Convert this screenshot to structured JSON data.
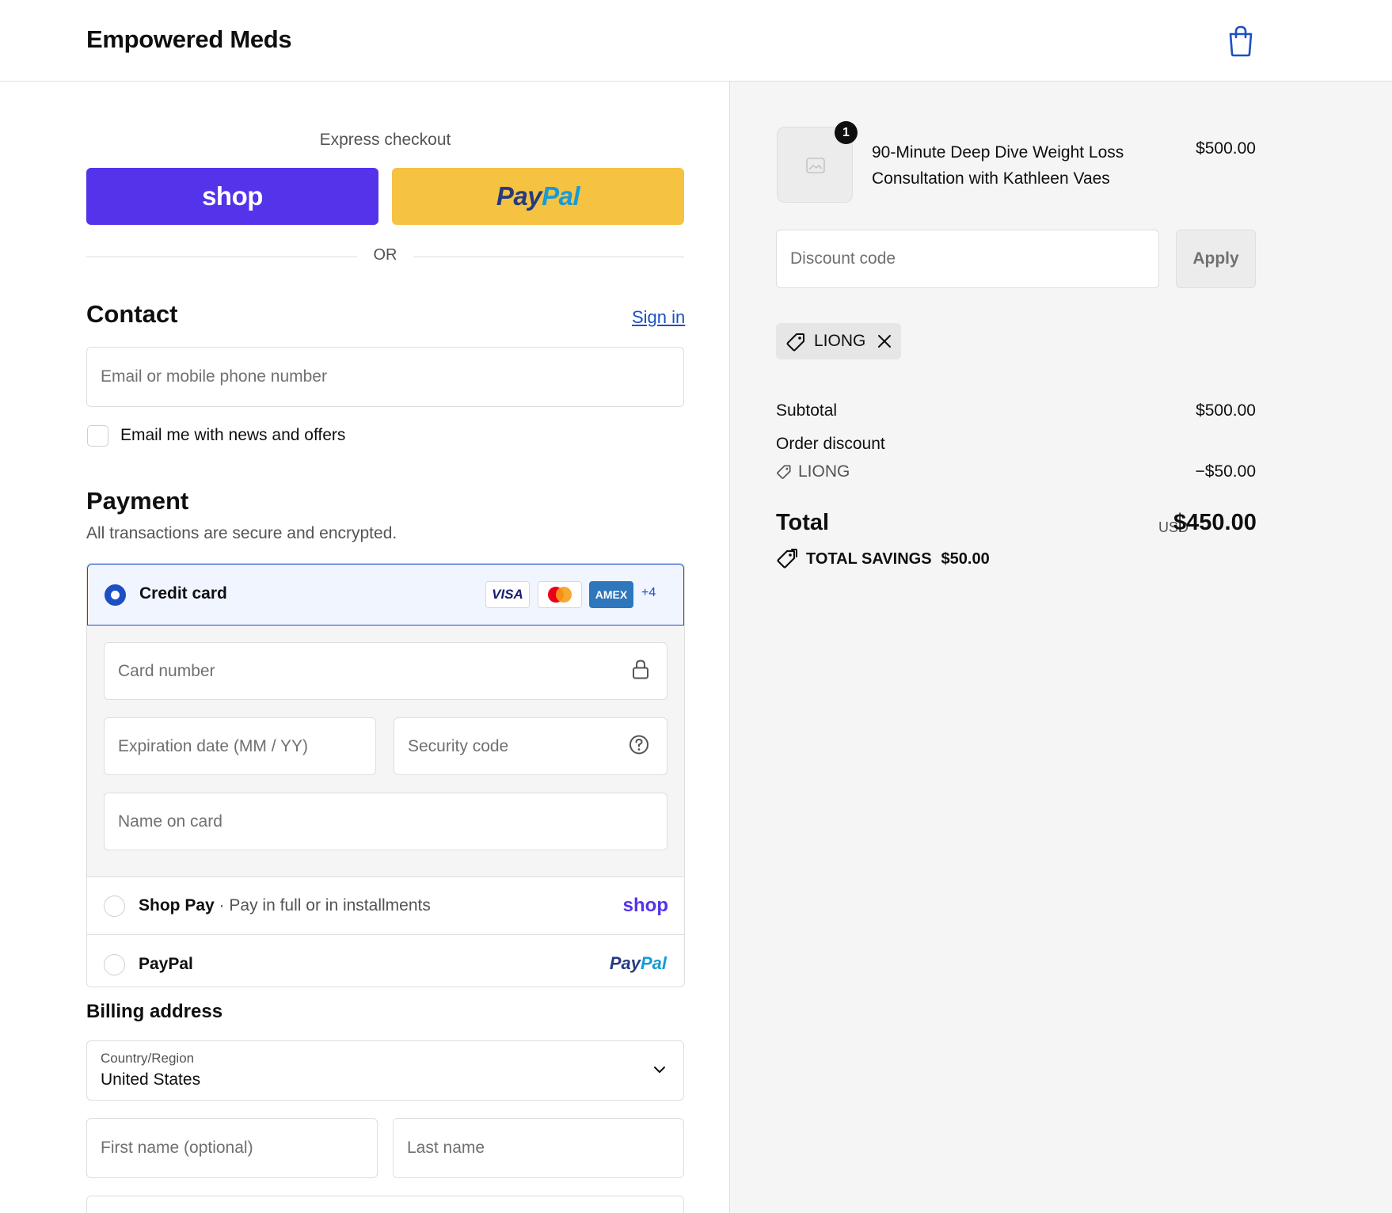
{
  "header": {
    "brand": "Empowered Meds",
    "cart_icon": "shopping-bag-icon"
  },
  "express": {
    "title": "Express checkout",
    "shop_label": "shop",
    "paypal_label_1": "Pay",
    "paypal_label_2": "Pal",
    "or_label": "OR"
  },
  "contact": {
    "heading": "Contact",
    "sign_in": "Sign in",
    "email_placeholder": "Email or mobile phone number",
    "newsletter_label": "Email me with news and offers"
  },
  "payment": {
    "heading": "Payment",
    "subtitle": "All transactions are secure and encrypted.",
    "credit_card_label": "Credit card",
    "card_badges": [
      "VISA",
      "mastercard",
      "AMEX",
      "+4"
    ],
    "card_number_placeholder": "Card number",
    "expiry_placeholder": "Expiration date (MM / YY)",
    "security_placeholder": "Security code",
    "name_placeholder": "Name on card",
    "shop_pay_label": "Shop Pay",
    "shop_pay_sub": "Pay in full or in installments",
    "shop_pay_logo": "shop",
    "paypal_label": "PayPal",
    "paypal_logo_1": "Pay",
    "paypal_logo_2": "Pal"
  },
  "billing": {
    "heading": "Billing address",
    "country_label": "Country/Region",
    "country_value": "United States",
    "first_name_placeholder": "First name (optional)",
    "last_name_placeholder": "Last name"
  },
  "summary": {
    "qty": "1",
    "product_name": "90-Minute Deep Dive Weight Loss Consultation with Kathleen Vaes",
    "product_price": "$500.00",
    "discount_placeholder": "Discount code",
    "apply_label": "Apply",
    "applied_code": "LIONG",
    "subtotal_label": "Subtotal",
    "subtotal_value": "$500.00",
    "order_discount_label": "Order discount",
    "discount_code": "LIONG",
    "discount_value": "−$50.00",
    "total_label": "Total",
    "currency": "USD",
    "total_value": "$450.00",
    "savings_label": "TOTAL SAVINGS",
    "savings_value": "$50.00"
  },
  "colors": {
    "shop_purple": "#5433eb",
    "paypal_yellow": "#f6c242",
    "accent_blue": "#1d4fc4"
  }
}
